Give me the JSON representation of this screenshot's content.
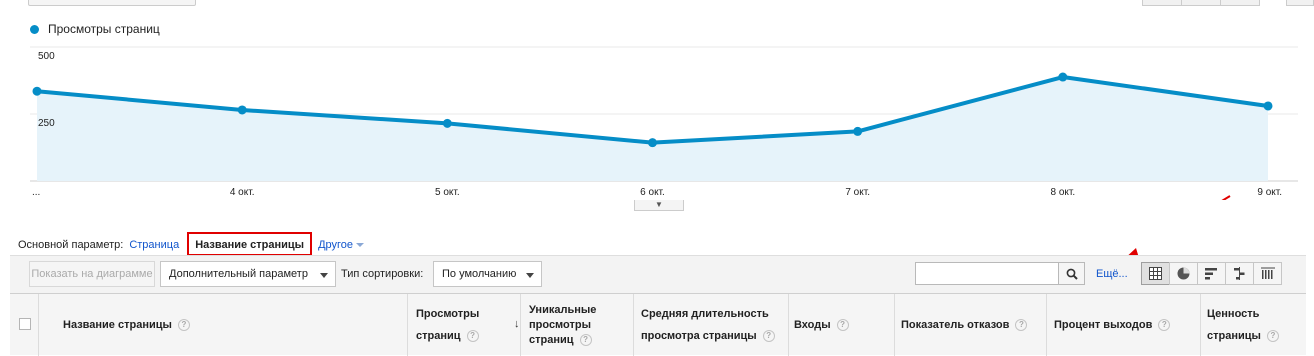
{
  "chart_data": {
    "type": "area",
    "series": [
      {
        "name": "Просмотры страниц",
        "values": [
          335,
          265,
          215,
          143,
          185,
          388,
          280
        ]
      }
    ],
    "categories": [
      "...",
      "4 окт.",
      "5 окт.",
      "6 окт.",
      "7 окт.",
      "8 окт.",
      "9 окт."
    ],
    "y_ticks": [
      "500",
      "250"
    ],
    "ylim": [
      0,
      500
    ],
    "grid": true,
    "legend_position": "top-left",
    "line_color": "#058dc7",
    "fill_color": "#e6f3fa"
  },
  "collapse_handle": {
    "icon": "chevron-down-icon"
  },
  "dimension": {
    "label": "Основной параметр:",
    "options": {
      "page": "Страница",
      "page_title": "Название страницы",
      "other": "Другое"
    }
  },
  "toolbar": {
    "plot_button": "Показать на диаграмме",
    "secondary_dimension": "Дополнительный параметр",
    "sort_label": "Тип сортировки:",
    "sort_value": "По умолчанию",
    "search_value": "",
    "more_link": "Ещё...",
    "views": [
      "table-icon",
      "pie-icon",
      "bar-icon",
      "comparison-icon",
      "pivot-icon"
    ]
  },
  "table": {
    "columns": [
      "Название страницы",
      "Просмотры страниц",
      "Уникальные просмотры страниц",
      "Средняя длительность просмотра страницы",
      "Входы",
      "Показатель отказов",
      "Процент выходов",
      "Ценность страницы"
    ],
    "help_glyph": "?",
    "sort_glyph": "↓"
  },
  "colors": {
    "accent": "#058dc7",
    "link": "#1155cc",
    "highlight_border": "#e00000",
    "annotation_arrow": "#e00000"
  }
}
